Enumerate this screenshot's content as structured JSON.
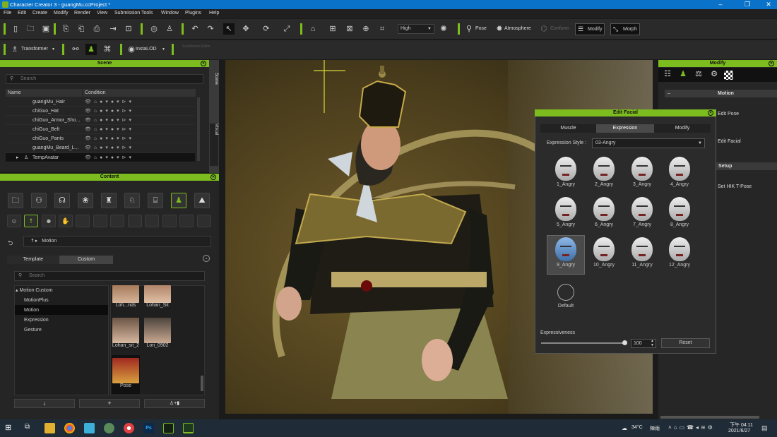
{
  "window": {
    "title": "Character Creator 3 - guangMu.ccProject *"
  },
  "menu": [
    "File",
    "Edit",
    "Create",
    "Modify",
    "Render",
    "View",
    "Submission Tools",
    "Window",
    "Plugins",
    "Help"
  ],
  "toolbar": {
    "quality": "High",
    "pose": "Pose",
    "atmosphere": "Atmosphere",
    "conform": "Conform",
    "modify": "Modify",
    "morph": "Morph",
    "transformer": "Transformer",
    "instalod": "InstaLOD",
    "subdivision": "Subdivision Editor"
  },
  "scene": {
    "title": "Scene",
    "search_placeholder": "Search",
    "col_name": "Name",
    "col_condition": "Condition",
    "side_scene": "Scene",
    "side_visual": "Visual",
    "rows": [
      "guangMu_Hair",
      "chiGuo_Hat",
      "chiGuo_Armor_Sho...",
      "chiGuo_Belt",
      "chiGuo_Pants",
      "guangMu_Beard_L...",
      "TempAvatar"
    ]
  },
  "content": {
    "title": "Content",
    "path": "Motion",
    "tab_template": "Template",
    "tab_custom": "Custom",
    "search_placeholder": "Search",
    "tree": {
      "root": "Motion Custom",
      "items": [
        "MotionPlus",
        "Motion",
        "Expression",
        "Gesture"
      ]
    },
    "thumbs": [
      "Loh...nds",
      "Lohan_Sit",
      "Lohan_sit_2",
      "Lori_0902",
      "Pose"
    ]
  },
  "modify": {
    "title": "Modify",
    "section_motion": "Motion",
    "edit_pose": "Edit Pose",
    "edit_facial": "Edit Facial",
    "section_setup": "Setup",
    "set_hik": "Set HIK T-Pose"
  },
  "edit_facial": {
    "title": "Edit Facial",
    "tabs": [
      "Muscle",
      "Expression",
      "Modify"
    ],
    "style_label": "Expression Style :",
    "style_value": "03-Angry",
    "expressions": [
      "1_Angry",
      "2_Angry",
      "3_Angry",
      "4_Angry",
      "5_Angry",
      "6_Angry",
      "7_Angry",
      "8_Angry",
      "9_Angry",
      "10_Angry",
      "11_Angry",
      "12_Angry"
    ],
    "default_label": "Default",
    "expressiveness_label": "Expressiveness",
    "expressiveness_value": "100",
    "reset": "Reset"
  },
  "taskbar": {
    "weather": "34°C",
    "weather_desc": "陣雨",
    "time": "下午 04:11",
    "date": "2021/6/27"
  },
  "colors": {
    "accent": "#7cbc1e",
    "title_bar": "#0b72c9"
  }
}
